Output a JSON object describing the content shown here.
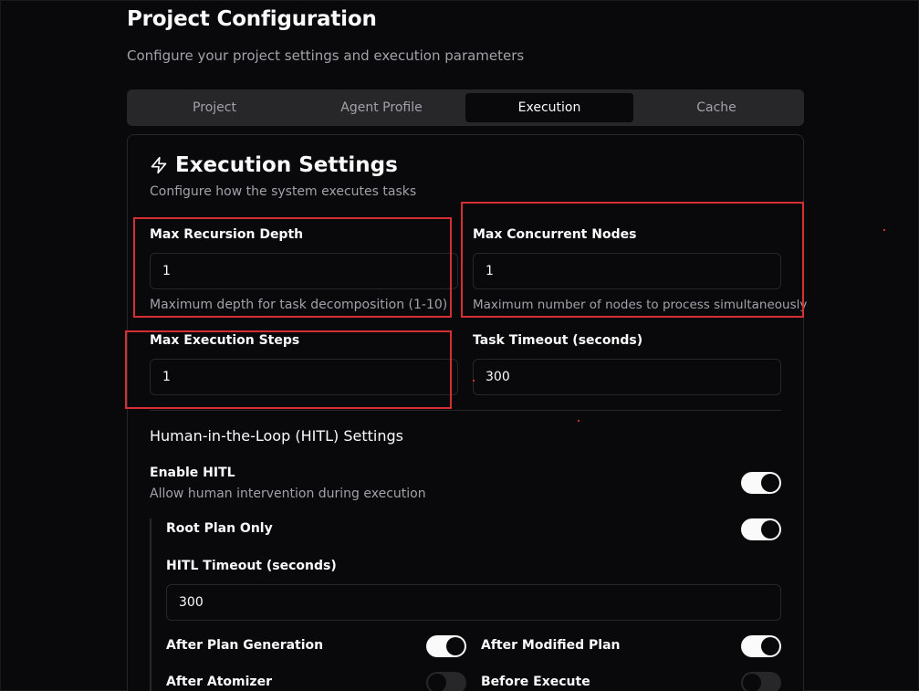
{
  "header": {
    "title": "Project Configuration",
    "subtitle": "Configure your project settings and execution parameters"
  },
  "tabs": [
    {
      "label": "Project",
      "active": false
    },
    {
      "label": "Agent Profile",
      "active": false
    },
    {
      "label": "Execution",
      "active": true
    },
    {
      "label": "Cache",
      "active": false
    }
  ],
  "execution": {
    "title": "Execution Settings",
    "title_icon": "lightning-bolt-icon",
    "description": "Configure how the system executes tasks",
    "fields": {
      "max_recursion_depth": {
        "label": "Max Recursion Depth",
        "value": "1",
        "help": "Maximum depth for task decomposition (1-10)"
      },
      "max_concurrent_nodes": {
        "label": "Max Concurrent Nodes",
        "value": "1",
        "help": "Maximum number of nodes to process simultaneously"
      },
      "max_execution_steps": {
        "label": "Max Execution Steps",
        "value": "1"
      },
      "task_timeout": {
        "label": "Task Timeout (seconds)",
        "value": "300"
      }
    }
  },
  "hitl": {
    "section_title": "Human-in-the-Loop (HITL) Settings",
    "enable": {
      "label": "Enable HITL",
      "description": "Allow human intervention during execution",
      "on": true
    },
    "root_plan_only": {
      "label": "Root Plan Only",
      "on": true
    },
    "timeout": {
      "label": "HITL Timeout (seconds)",
      "value": "300"
    },
    "after_plan_generation": {
      "label": "After Plan Generation",
      "on": true
    },
    "after_modified_plan": {
      "label": "After Modified Plan",
      "on": true
    },
    "after_atomizer": {
      "label": "After Atomizer",
      "on": false
    },
    "before_execute": {
      "label": "Before Execute",
      "on": false
    }
  },
  "colors": {
    "background": "#09090b",
    "highlight": "#d62f33",
    "toggle_on": "#fafafa",
    "toggle_off": "#27272a",
    "muted_text": "#a1a1aa"
  }
}
